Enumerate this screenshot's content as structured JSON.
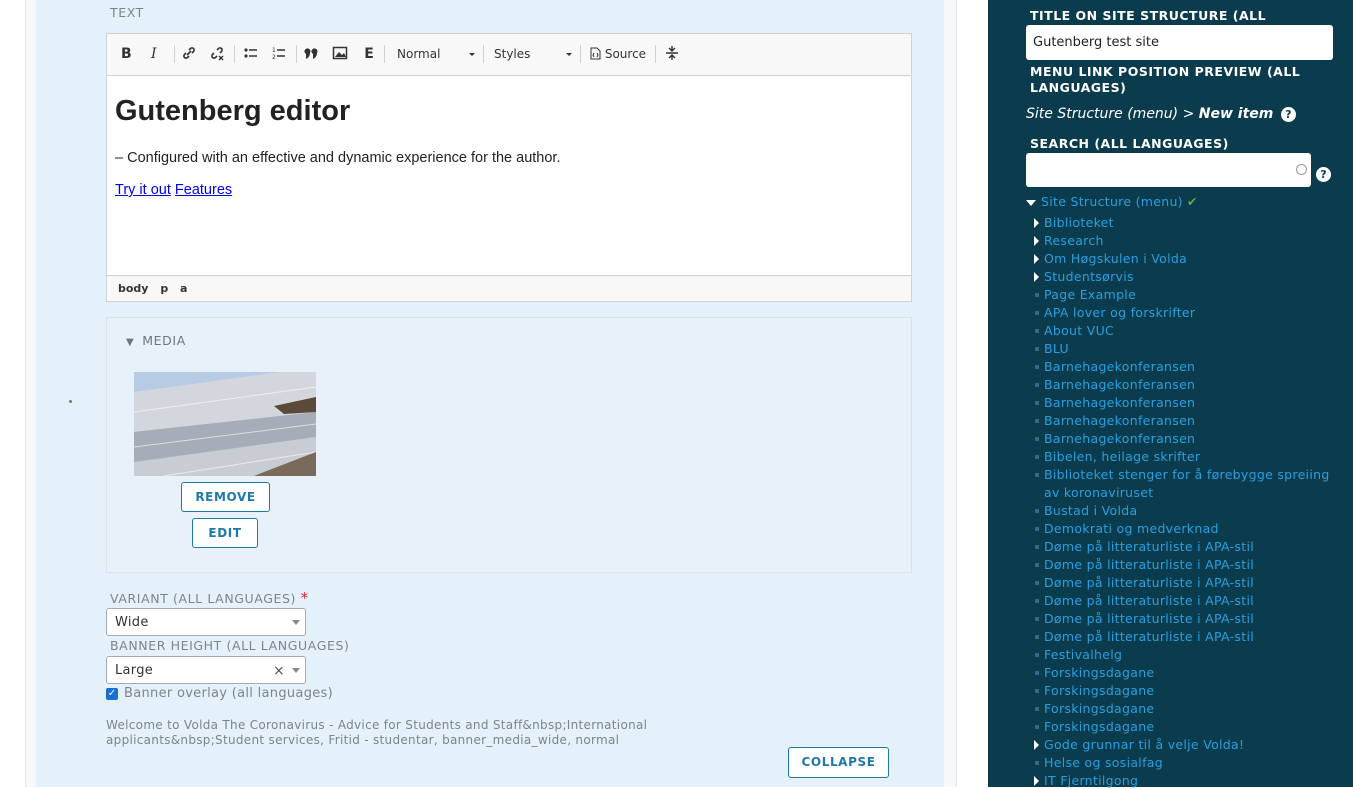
{
  "text_field": {
    "label": "TEXT",
    "toolbar": {
      "bold": "B",
      "italic": "I",
      "format_select": "Normal",
      "styles_select": "Styles",
      "source": "Source"
    },
    "content": {
      "heading": "Gutenberg editor",
      "paragraph": "– Configured with an effective and dynamic experience for the author.",
      "link1": "Try it out",
      "link2": "Features"
    },
    "path": [
      "body",
      "p",
      "a"
    ]
  },
  "media": {
    "title": "MEDIA",
    "remove_label": "REMOVE",
    "edit_label": "EDIT"
  },
  "variant": {
    "label": "VARIANT (ALL LANGUAGES)",
    "required": "*",
    "value": "Wide"
  },
  "banner_height": {
    "label": "BANNER HEIGHT (ALL LANGUAGES)",
    "value": "Large",
    "clear": "×"
  },
  "banner_overlay": {
    "label": "Banner overlay (all languages)",
    "checked": true
  },
  "summary": "Welcome to Volda The Coronavirus - Advice for Students and Staff&nbsp;International applicants&nbsp;Student services, Fritid - studentar, banner_media_wide, normal",
  "collapse_label": "COLLAPSE",
  "sidebar": {
    "title_label": "TITLE ON SITE STRUCTURE (ALL LANGUAGES)",
    "title_required": "*",
    "title_value": "Gutenberg test site",
    "menu_preview_label": "MENU LINK POSITION PREVIEW (ALL LANGUAGES)",
    "preview_path": "Site Structure (menu) >",
    "preview_new": "New item",
    "help": "?",
    "search_label": "SEARCH (ALL LANGUAGES)",
    "tree_root": "Site Structure (menu)",
    "tree_check": "✔",
    "tree": [
      {
        "label": "Biblioteket",
        "expandable": true
      },
      {
        "label": "Research",
        "expandable": true
      },
      {
        "label": "Om Høgskulen i Volda",
        "expandable": true
      },
      {
        "label": "Studentsørvis",
        "expandable": true
      },
      {
        "label": "Page Example",
        "expandable": false
      },
      {
        "label": "APA lover og forskrifter",
        "expandable": false
      },
      {
        "label": "About VUC",
        "expandable": false
      },
      {
        "label": "BLU",
        "expandable": false
      },
      {
        "label": "Barnehagekonferansen",
        "expandable": false
      },
      {
        "label": "Barnehagekonferansen",
        "expandable": false
      },
      {
        "label": "Barnehagekonferansen",
        "expandable": false
      },
      {
        "label": "Barnehagekonferansen",
        "expandable": false
      },
      {
        "label": "Barnehagekonferansen",
        "expandable": false
      },
      {
        "label": "Bibelen, heilage skrifter",
        "expandable": false
      },
      {
        "label": "Biblioteket stenger for å førebygge spreiing av koronaviruset",
        "expandable": false
      },
      {
        "label": "Bustad i Volda",
        "expandable": false
      },
      {
        "label": "Demokrati og medverknad",
        "expandable": false
      },
      {
        "label": "Døme på litteraturliste i APA-stil",
        "expandable": false
      },
      {
        "label": "Døme på litteraturliste i APA-stil",
        "expandable": false
      },
      {
        "label": "Døme på litteraturliste i APA-stil",
        "expandable": false
      },
      {
        "label": "Døme på litteraturliste i APA-stil",
        "expandable": false
      },
      {
        "label": "Døme på litteraturliste i APA-stil",
        "expandable": false
      },
      {
        "label": "Døme på litteraturliste i APA-stil",
        "expandable": false
      },
      {
        "label": "Festivalhelg",
        "expandable": false
      },
      {
        "label": "Forskingsdagane",
        "expandable": false
      },
      {
        "label": "Forskingsdagane",
        "expandable": false
      },
      {
        "label": "Forskingsdagane",
        "expandable": false
      },
      {
        "label": "Forskingsdagane",
        "expandable": false
      },
      {
        "label": "Gode grunnar til å velje Volda!",
        "expandable": true
      },
      {
        "label": "Helse og sosialfag",
        "expandable": false
      },
      {
        "label": "IT Fjerntilgong",
        "expandable": true
      }
    ]
  }
}
